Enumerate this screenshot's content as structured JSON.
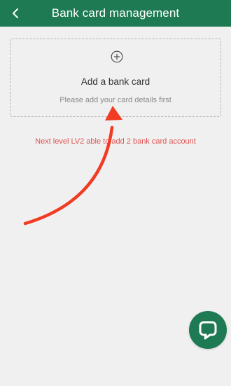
{
  "header": {
    "title": "Bank card management",
    "back_icon": "chevron-left-icon"
  },
  "add_card": {
    "icon": "plus-circle-icon",
    "title": "Add a bank card",
    "subtitle": "Please add your card details first"
  },
  "level_note": "Next level LV2 able to add 2 bank card account",
  "chat_button": {
    "icon": "chat-bubble-icon"
  },
  "colors": {
    "brand": "#1d7a52",
    "background": "#f0f0f0",
    "note": "#e05353",
    "arrow": "#f13b22"
  }
}
